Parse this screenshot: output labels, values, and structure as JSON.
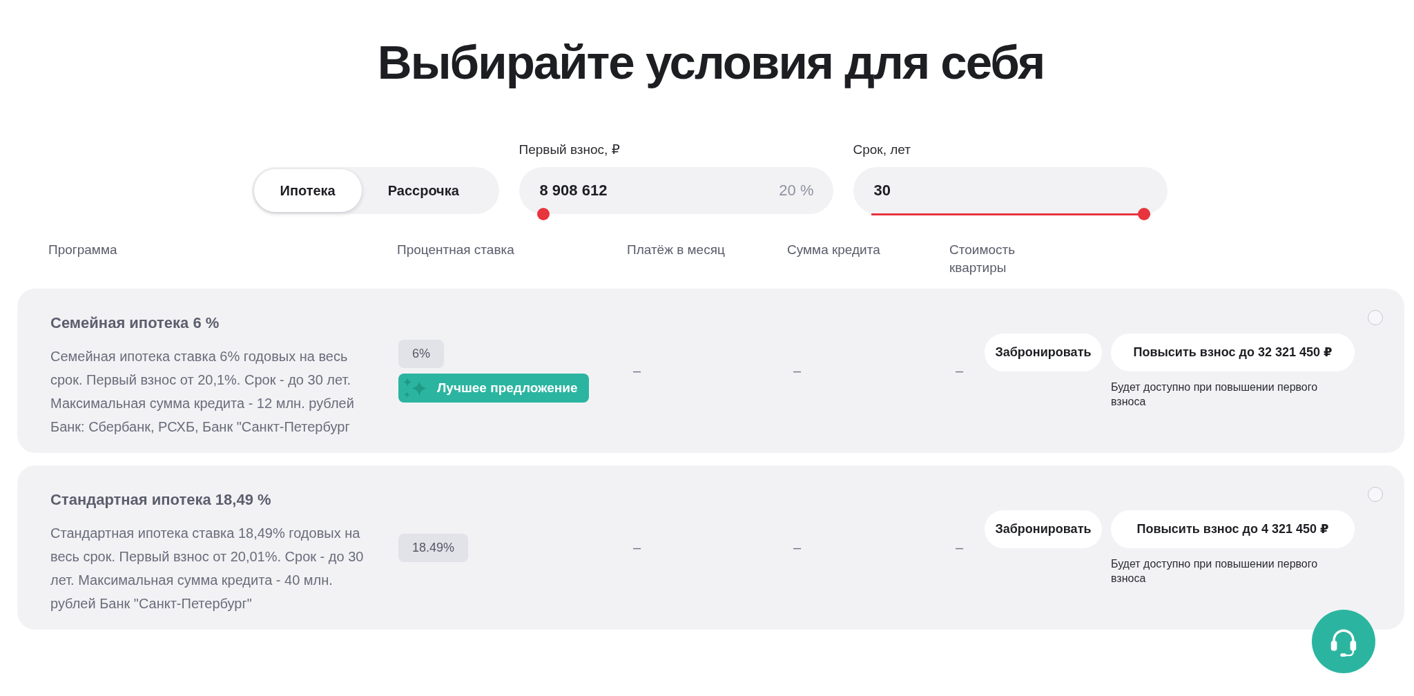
{
  "title": "Выбирайте условия для себя",
  "mode_tabs": [
    {
      "label": "Ипотека",
      "selected": true
    },
    {
      "label": "Рассрочка",
      "selected": false
    }
  ],
  "down_payment": {
    "label": "Первый взнос, ₽",
    "value": "8 908 612",
    "percent": "20 %",
    "level": 0
  },
  "term": {
    "label": "Срок, лет",
    "value": "30",
    "level": 1
  },
  "table": {
    "columns": [
      "Программа",
      "Процентная ставка",
      "Платёж в месяц",
      "Сумма кредита",
      "Стоимость квартиры"
    ],
    "rows": [
      {
        "title": "Семейная ипотека 6 %",
        "description": "Семейная ипотека ставка 6% годовых на весь срок. Первый взнос от 20,1%. Срок - до 30 лет. Максимальная сумма кредита - 12 млн. рублей Банк: Сбербанк, РСХБ, Банк \"Санкт-Петербург",
        "rate": "6%",
        "badge": "Лучшее предложение",
        "payment": "–",
        "loan_amount": "–",
        "apartment_cost": "–",
        "book_button": "Забронировать",
        "raise_button": "Повысить взнос до 32 321 450 ₽",
        "note": "Будет доступно при повышении первого взноса",
        "selected": false
      },
      {
        "title": "Стандартная ипотека 18,49 %",
        "description": "Стандартная ипотека ставка 18,49% годовых на весь срок. Первый взнос от 20,01%. Срок - до 30 лет. Максимальная сумма кредита - 40 млн. рублей Банк \"Санкт-Петербург\"",
        "rate": "18.49%",
        "payment": "–",
        "loan_amount": "–",
        "apartment_cost": "–",
        "book_button": "Забронировать",
        "raise_button": "Повысить взнос до 4 321 450 ₽",
        "note": "Будет доступно при повышении первого взноса",
        "selected": false
      }
    ]
  }
}
